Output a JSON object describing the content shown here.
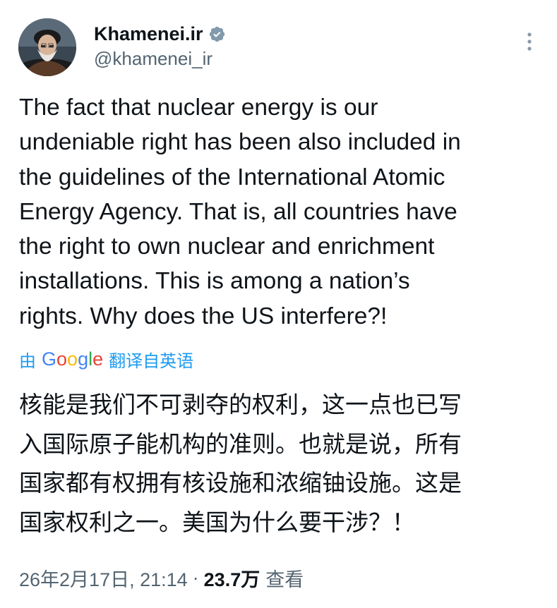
{
  "author": {
    "display_name": "Khamenei.ir",
    "handle": "@khamenei_ir",
    "verified_icon": "verified-badge-icon",
    "more_icon": "vertical-ellipsis-icon"
  },
  "tweet": {
    "text_lines": [
      "The fact that nuclear energy is our",
      "undeniable right has been also included in",
      "the guidelines of the International Atomic",
      "Energy Agency. That is, all countries have",
      "the right to own nuclear and enrichment",
      "installations. This is among a nation’s",
      "rights. Why does the US interfere?!"
    ]
  },
  "translation": {
    "prefix": "由",
    "provider": "Google",
    "suffix": "翻译自英语",
    "text_lines": [
      "核能是我们不可剥夺的权利，这一点也已写",
      "入国际原子能机构的准则。也就是说，所有",
      "国家都有权拥有核设施和浓缩铀设施。这是",
      "国家权利之一。美国为什么要干涉？！"
    ]
  },
  "meta": {
    "timestamp": "26年2月17日, 21:14",
    "separator": "·",
    "views_count": "23.7万",
    "views_label": "查看"
  },
  "colors": {
    "accent": "#1d9bf0",
    "text_primary": "#0f1419",
    "text_secondary": "#536471"
  }
}
